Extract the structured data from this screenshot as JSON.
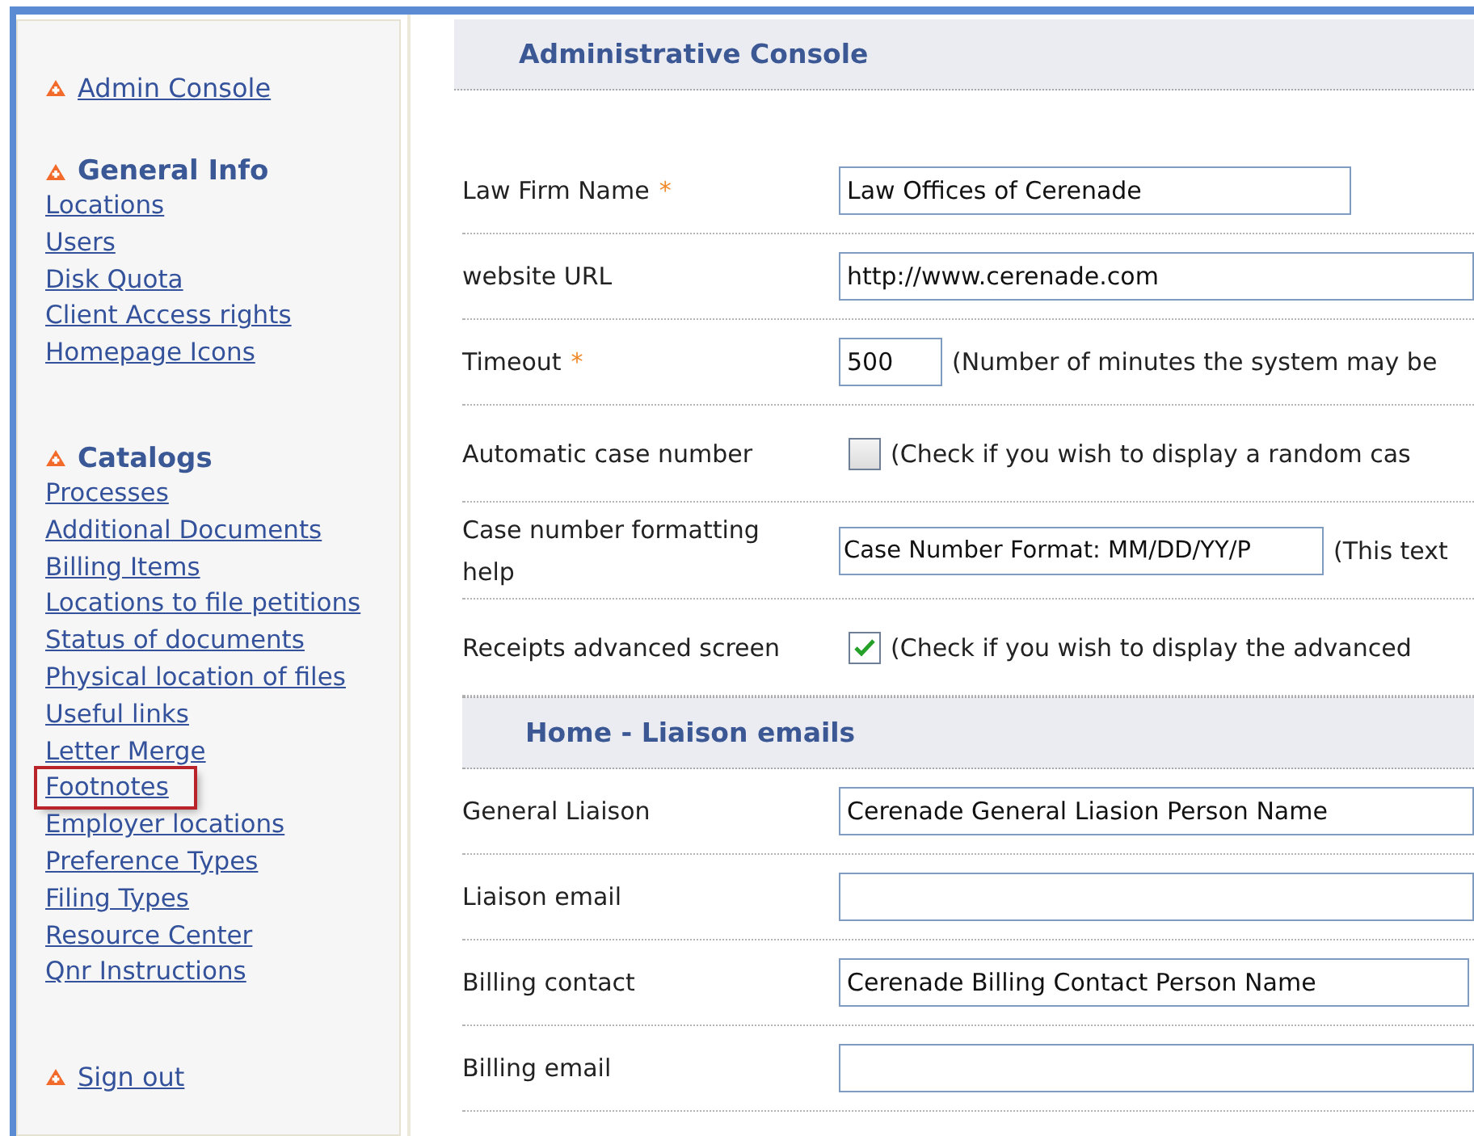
{
  "sidebar": {
    "sections": [
      {
        "heading": "Admin Console",
        "kind": "link"
      },
      {
        "heading": "General Info",
        "kind": "group",
        "items": [
          {
            "label": "Locations",
            "highlighted": false
          },
          {
            "label": "Users",
            "highlighted": false
          },
          {
            "label": "Disk Quota",
            "highlighted": false
          },
          {
            "label": "Client Access rights",
            "highlighted": false
          },
          {
            "label": "Homepage Icons",
            "highlighted": false
          }
        ]
      },
      {
        "heading": "Catalogs",
        "kind": "group",
        "items": [
          {
            "label": "Processes",
            "highlighted": false
          },
          {
            "label": "Additional Documents",
            "highlighted": false
          },
          {
            "label": "Billing Items",
            "highlighted": false
          },
          {
            "label": "Locations to file petitions",
            "highlighted": false
          },
          {
            "label": "Status of documents",
            "highlighted": false
          },
          {
            "label": "Physical location of files",
            "highlighted": false
          },
          {
            "label": "Useful links",
            "highlighted": false
          },
          {
            "label": "Letter Merge",
            "highlighted": false
          },
          {
            "label": "Footnotes",
            "highlighted": true
          },
          {
            "label": "Employer locations",
            "highlighted": false
          },
          {
            "label": "Preference Types",
            "highlighted": false
          },
          {
            "label": "Filing Types",
            "highlighted": false
          },
          {
            "label": "Resource Center",
            "highlighted": false
          },
          {
            "label": "Qnr Instructions",
            "highlighted": false
          }
        ]
      },
      {
        "heading": "Sign out",
        "kind": "link"
      }
    ]
  },
  "main": {
    "sections": [
      {
        "title": "Administrative Console",
        "rows": [
          {
            "label": "Law Firm Name",
            "required_mark": "*",
            "kind": "short-text",
            "value": "Law Offices of Cerenade"
          },
          {
            "label": "website URL",
            "kind": "text",
            "value": "http://www.cerenade.com"
          },
          {
            "label": "Timeout",
            "required_mark": "*",
            "kind": "number",
            "value": "500",
            "note": "(Number of minutes the system may be"
          },
          {
            "label": "Automatic case number",
            "kind": "checkbox",
            "checked": false,
            "note": "(Check if you wish to display a random cas"
          },
          {
            "label": "Case number formatting help",
            "kind": "medium-text",
            "value": "Case Number Format: MM/DD/YY/P",
            "note": "(This text"
          },
          {
            "label": "Receipts advanced screen",
            "kind": "checkbox",
            "checked": true,
            "note": "(Check if you wish to display the advanced"
          }
        ]
      },
      {
        "title": "Home - Liaison emails",
        "rows": [
          {
            "label": "General Liaison",
            "kind": "text",
            "value": "Cerenade General Liasion Person Name"
          },
          {
            "label": "Liaison email",
            "kind": "text",
            "value": ""
          },
          {
            "label": "Billing contact",
            "kind": "long-text",
            "value": "Cerenade Billing Contact Person Name"
          },
          {
            "label": "Billing email",
            "kind": "text",
            "value": ""
          }
        ]
      }
    ]
  }
}
